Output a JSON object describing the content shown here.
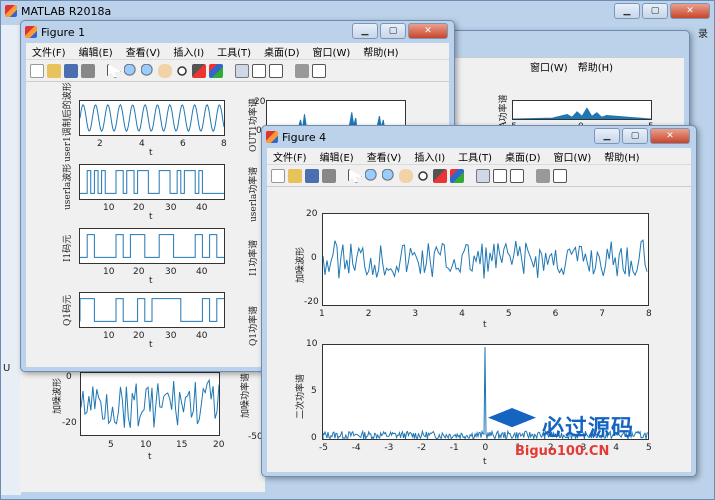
{
  "app_title": "MATLAB R2018a",
  "menu": [
    "文件(F)",
    "编辑(E)",
    "查看(V)",
    "插入(I)",
    "工具(T)",
    "桌面(D)",
    "窗口(W)",
    "帮助(H)"
  ],
  "figure1": {
    "title": "Figure 1",
    "left_axes": [
      {
        "ylabel": "user1调制后的波形",
        "xlabel": "t",
        "xticks": [
          "2",
          "4",
          "6",
          "8"
        ]
      },
      {
        "ylabel": "userla波形",
        "xlabel": "t",
        "xticks": [
          "10",
          "20",
          "30",
          "40"
        ]
      },
      {
        "ylabel": "I1码元",
        "xlabel": "t",
        "xticks": [
          "10",
          "20",
          "30",
          "40"
        ]
      },
      {
        "ylabel": "Q1码元",
        "xlabel": "t",
        "xticks": [
          "10",
          "20",
          "30",
          "40"
        ]
      }
    ],
    "right_axes": [
      {
        "ylabel": "OUT1功率谱",
        "yticks": [
          "20",
          "0"
        ]
      },
      {
        "ylabel": "userla功率谱"
      },
      {
        "ylabel": "I1功率谱"
      },
      {
        "ylabel": "Q1功率谱"
      }
    ]
  },
  "figure4": {
    "title": "Figure 4",
    "top_axis": {
      "ylabel": "加噪波形",
      "xlabel": "t",
      "yticks": [
        "20",
        "0",
        "-20"
      ],
      "xticks": [
        "1",
        "2",
        "3",
        "4",
        "5",
        "6",
        "7",
        "8"
      ]
    },
    "bottom_axis": {
      "ylabel": "二次功率谱",
      "xlabel": "t",
      "yticks": [
        "10",
        "5",
        "0"
      ],
      "xticks": [
        "-5",
        "-4",
        "-3",
        "-2",
        "-1",
        "0",
        "1",
        "2",
        "3",
        "4",
        "5"
      ]
    }
  },
  "background": {
    "right_axis_ylabel": "A功率谱",
    "right_axis_xticks": [
      "-5",
      "0",
      "5"
    ],
    "lower_left": {
      "ylabel": "加噪波形",
      "yticks": [
        "0",
        "-20"
      ],
      "xticks": [
        "5",
        "10",
        "15",
        "20"
      ],
      "xlabel": "t"
    },
    "lower_mid_ylabel": "加噪功率谱",
    "lower_mid_tick": "-50",
    "side_text_u": "U",
    "side_text_lu": "录"
  },
  "watermark": {
    "line1": "必过源码",
    "line2": "Biguo100.CN"
  }
}
